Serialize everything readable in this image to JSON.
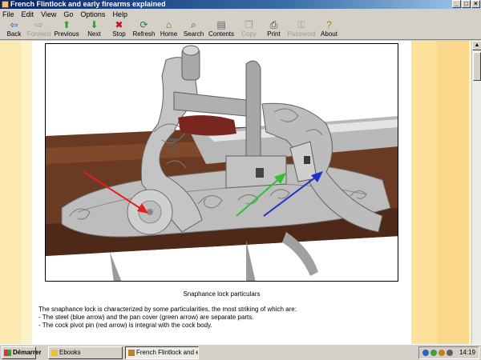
{
  "window": {
    "title": "French Flintlock and early firearms explained"
  },
  "menu": [
    "File",
    "Edit",
    "View",
    "Go",
    "Options",
    "Help"
  ],
  "toolbar": [
    {
      "label": "Back",
      "icon": "back-arrow-icon",
      "glyph": "⇦",
      "color": "#1a64b4",
      "enabled": true
    },
    {
      "label": "Forward",
      "icon": "forward-arrow-icon",
      "glyph": "⇨",
      "color": "#9a9a9a",
      "enabled": false
    },
    {
      "label": "Previous",
      "icon": "up-arrow-icon",
      "glyph": "⬆",
      "color": "#2ea02e",
      "enabled": true
    },
    {
      "label": "Next",
      "icon": "down-arrow-icon",
      "glyph": "⬇",
      "color": "#2ea02e",
      "enabled": true
    },
    {
      "label": "Stop",
      "icon": "stop-icon",
      "glyph": "✖",
      "color": "#d01010",
      "enabled": true
    },
    {
      "label": "Refresh",
      "icon": "refresh-icon",
      "glyph": "⟳",
      "color": "#208040",
      "enabled": true
    },
    {
      "label": "Home",
      "icon": "home-icon",
      "glyph": "⌂",
      "color": "#806020",
      "enabled": true
    },
    {
      "label": "Search",
      "icon": "search-icon",
      "glyph": "⌕",
      "color": "#304080",
      "enabled": true
    },
    {
      "label": "Contents",
      "icon": "contents-icon",
      "glyph": "▤",
      "color": "#606060",
      "enabled": true
    },
    {
      "label": "Copy",
      "icon": "copy-icon",
      "glyph": "❐",
      "color": "#9a9a9a",
      "enabled": false
    },
    {
      "label": "Print",
      "icon": "print-icon",
      "glyph": "⎙",
      "color": "#404040",
      "enabled": true
    },
    {
      "label": "Password",
      "icon": "key-icon",
      "glyph": "⚿",
      "color": "#9a9a9a",
      "enabled": false
    },
    {
      "label": "About",
      "icon": "about-icon",
      "glyph": "?",
      "color": "#a08000",
      "enabled": true
    }
  ],
  "page": {
    "caption": "Snaphance lock particulars",
    "paragraph": [
      "The snaphance lock is characterized by some particularities, the most striking of which are:",
      "- The steel (blue arrow) and the pan cover (green arrow) are separate parts.",
      "- The cock pivot pin (red arrow) is integral with the cock body."
    ]
  },
  "arrows": [
    {
      "name": "red-arrow",
      "color": "#e02020"
    },
    {
      "name": "green-arrow",
      "color": "#30c030"
    },
    {
      "name": "blue-arrow",
      "color": "#2030d0"
    }
  ],
  "taskbar": {
    "start_label": "Démarrer",
    "tasks": [
      "Ebooks",
      "French Flintlock and e..."
    ],
    "clock": "14:19"
  }
}
